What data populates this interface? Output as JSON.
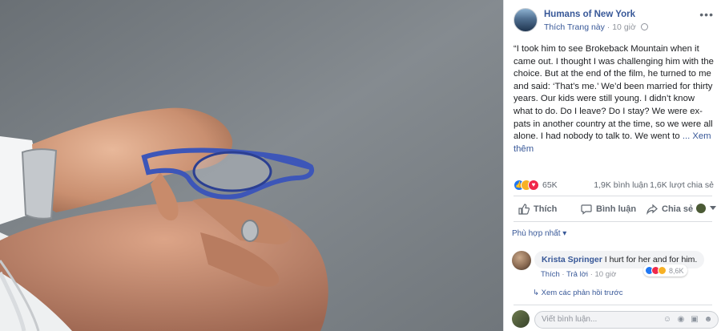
{
  "post": {
    "page_name": "Humans of New York",
    "like_page": "Thích Trang này",
    "dot": "·",
    "time": "10 giờ",
    "more": "•••",
    "text": "“I took him to see Brokeback Mountain when it came out. I thought I was challenging him with the choice. But at the end of the film, he turned to me and said: ‘That’s me.’ We’d been married for thirty years. Our kids were still young. I didn’t know what to do. Do I leave? Do I stay? We were ex-pats in another country at the time, so we were all alone. I had nobody to talk to. We went to",
    "see_more": "... Xem thêm"
  },
  "reactions": {
    "count": "65K",
    "comments": "1,9K bình luận",
    "shares": "1,6K lượt chia sẻ",
    "colors": {
      "like": "#2078f4",
      "sad": "#f7b125",
      "love": "#f0284a"
    }
  },
  "actions": {
    "like": "Thích",
    "comment": "Bình luận",
    "share": "Chia sẻ"
  },
  "comments": {
    "sort_label": "Phù hợp nhất",
    "items": [
      {
        "author": "Krista Springer",
        "text": "I hurt for her and for him.",
        "like": "Thích",
        "reply": "Trả lời",
        "time": "10 giờ",
        "reaction_count": "8,6K"
      }
    ],
    "previous_replies": "Xem các phản hồi trước"
  },
  "composer": {
    "placeholder": "Viết bình luận..."
  },
  "theme": {
    "link": "#385898",
    "muted": "#90949c"
  }
}
